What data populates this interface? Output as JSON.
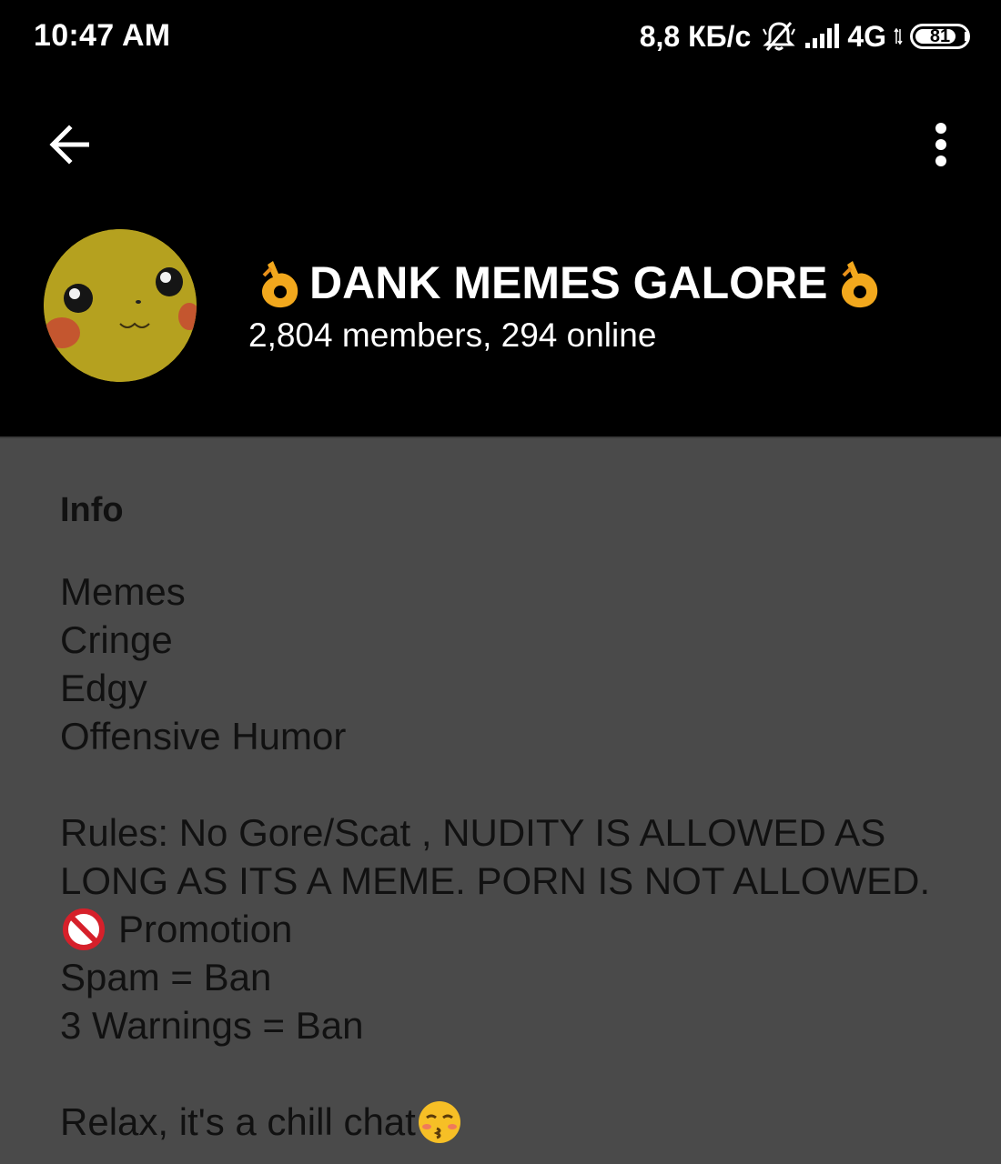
{
  "status_bar": {
    "time": "10:47 AM",
    "network_speed": "8,8 КБ/с",
    "network_type": "4G",
    "battery_level": "81",
    "battery_percent": 81,
    "icons": [
      "alarm-off-icon",
      "signal-icon",
      "battery-icon"
    ]
  },
  "header": {
    "title": "DANK MEMES GALORE",
    "title_decoration_icon": "ok-hand-emoji",
    "subtitle": "2,804 members, 294 online",
    "back_icon": "arrow-left-icon",
    "menu_icon": "more-vertical-icon",
    "avatar_icon": "pikachu-face-avatar",
    "background_color": "#000000"
  },
  "info": {
    "heading": "Info",
    "lines": {
      "l1": "Memes",
      "l2": "Cringe",
      "l3": "Edgy",
      "l4": "Offensive Humor",
      "rules_1": "Rules: No Gore/Scat , NUDITY IS ALLOWED AS",
      "rules_2": "LONG AS ITS A MEME. PORN IS NOT ALLOWED.",
      "promotion": "Promotion",
      "promotion_icon": "prohibited-emoji",
      "spam": "Spam = Ban",
      "warnings": "3 Warnings = Ban",
      "relax": "Relax, it's a chill chat",
      "relax_icon": "kissing-closed-eyes-emoji"
    },
    "background_color": "#4a4a4a",
    "text_color": "#111111"
  }
}
